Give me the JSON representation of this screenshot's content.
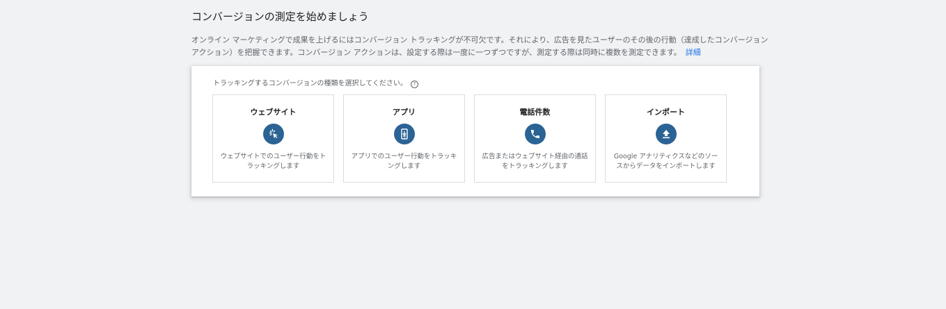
{
  "header": {
    "title": "コンバージョンの測定を始めましょう"
  },
  "intro": {
    "text": "オンライン マーケティングで成果を上げるにはコンバージョン トラッキングが不可欠です。それにより、広告を見たユーザーのその後の行動（達成したコンバージョン アクション）を把握できます。コンバージョン アクションは、設定する際は一度に一つずつですが、測定する際は同時に複数を測定できます。",
    "link_label": "詳細"
  },
  "panel": {
    "prompt": "トラッキングするコンバージョンの種類を選択してください。",
    "help_icon_label": "?",
    "cards": [
      {
        "title": "ウェブサイト",
        "icon": "cursor-click-icon",
        "description": "ウェブサイトでのユーザー行動をトラッキングします"
      },
      {
        "title": "アプリ",
        "icon": "phone-download-icon",
        "description": "アプリでのユーザー行動をトラッキングします"
      },
      {
        "title": "電話件数",
        "icon": "phone-call-icon",
        "description": "広告またはウェブサイト経由の通話をトラッキングします"
      },
      {
        "title": "インポート",
        "icon": "upload-icon",
        "description": "Google アナリティクスなどのソースからデータをインポートします"
      }
    ]
  },
  "colors": {
    "background": "#f1f2f4",
    "icon_circle": "#2b6395",
    "link": "#1a73e8"
  }
}
